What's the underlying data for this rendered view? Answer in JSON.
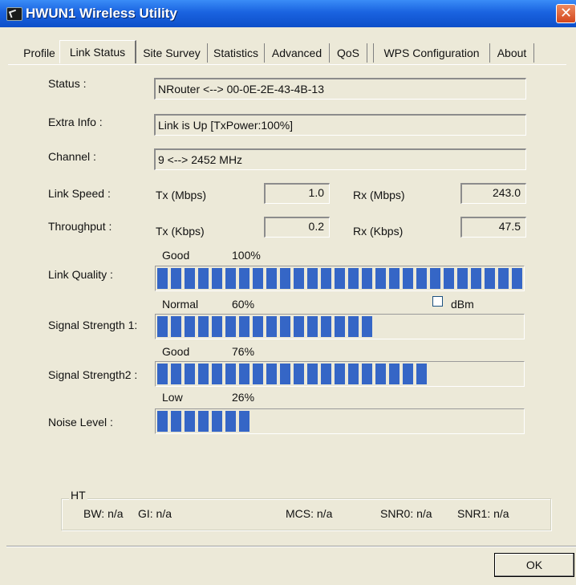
{
  "window": {
    "title": "HWUN1 Wireless Utility",
    "close_glyph": "✕"
  },
  "tabs": [
    {
      "label": "Profile"
    },
    {
      "label": "Link Status",
      "active": true
    },
    {
      "label": "Site Survey"
    },
    {
      "label": "Statistics"
    },
    {
      "label": "Advanced"
    },
    {
      "label": "QoS"
    },
    {
      "label": "WPS Configuration"
    },
    {
      "label": "About"
    }
  ],
  "status": {
    "label": "Status :",
    "value": "NRouter <--> 00-0E-2E-43-4B-13"
  },
  "extra_info": {
    "label": "Extra Info :",
    "value": "Link is Up [TxPower:100%]"
  },
  "channel": {
    "label": "Channel :",
    "value": "9 <--> 2452 MHz"
  },
  "link_speed": {
    "label": "Link Speed :",
    "tx_label": "Tx (Mbps)",
    "tx_value": "1.0",
    "rx_label": "Rx (Mbps)",
    "rx_value": "243.0"
  },
  "throughput": {
    "label": "Throughput :",
    "tx_label": "Tx (Kbps)",
    "tx_value": "0.2",
    "rx_label": "Rx (Kbps)",
    "rx_value": "47.5"
  },
  "link_quality": {
    "label": "Link Quality :",
    "rating": "Good",
    "percent_text": "100%",
    "percent": 100
  },
  "signal1": {
    "label": "Signal Strength 1:",
    "rating": "Normal",
    "percent_text": "60%",
    "percent": 60
  },
  "dbm": {
    "label": "dBm",
    "checked": false
  },
  "signal2": {
    "label": "Signal Strength2 :",
    "rating": "Good",
    "percent_text": "76%",
    "percent": 76
  },
  "noise": {
    "label": "Noise Level :",
    "rating": "Low",
    "percent_text": "26%",
    "percent": 26
  },
  "ht": {
    "title": "HT",
    "bw": "BW: n/a",
    "gi": "GI: n/a",
    "mcs": "MCS: n/a",
    "snr0": "SNR0: n/a",
    "snr1": "SNR1: n/a"
  },
  "ok_label": "OK",
  "colors": {
    "titlebar": "#1a63e0",
    "meter_fill": "#3566c6",
    "dialog_bg": "#ece9d8"
  }
}
